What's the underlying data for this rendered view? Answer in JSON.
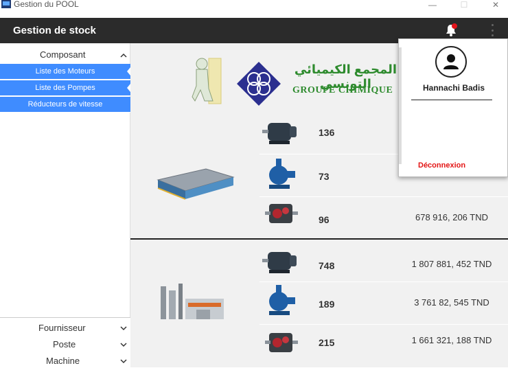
{
  "window": {
    "title": "Gestion du POOL",
    "minimize": "—",
    "maximize": "☐",
    "close": "✕"
  },
  "appbar": {
    "title": "Gestion de stock"
  },
  "sidebar": {
    "section": "Composant",
    "items": [
      {
        "label": "Liste des Moteurs"
      },
      {
        "label": "Liste des Pompes"
      },
      {
        "label": "Réducteurs de vitesse"
      }
    ],
    "bottom": [
      {
        "label": "Fournisseur"
      },
      {
        "label": "Poste"
      },
      {
        "label": "Machine"
      }
    ]
  },
  "logo": {
    "arabic_text": "المجمع الكيميائي التونسي",
    "latin_text": "GROUPE CHIMIQUE"
  },
  "stock_groups": [
    {
      "site_icon": "warehouse-icon",
      "rows": [
        {
          "icon": "motor-icon",
          "qty": "136",
          "value": ""
        },
        {
          "icon": "pump-icon",
          "qty": "73",
          "value": ""
        },
        {
          "icon": "gear-reducer-icon",
          "qty": "96",
          "value": "678 916, 206 TND"
        }
      ]
    },
    {
      "site_icon": "factory-icon",
      "rows": [
        {
          "icon": "motor-icon",
          "qty": "748",
          "value": "1 807 881, 452 TND"
        },
        {
          "icon": "pump-icon",
          "qty": "189",
          "value": "3 761 82, 545 TND"
        },
        {
          "icon": "gear-reducer-icon",
          "qty": "215",
          "value": "1 661 321, 188 TND"
        }
      ]
    }
  ],
  "user_menu": {
    "name": "Hannachi Badis",
    "logout": "Déconnexion"
  },
  "colors": {
    "accent": "#3f8cff",
    "appbar": "#2b2b2b",
    "logout": "#e31414",
    "notification": "#e3141b"
  }
}
